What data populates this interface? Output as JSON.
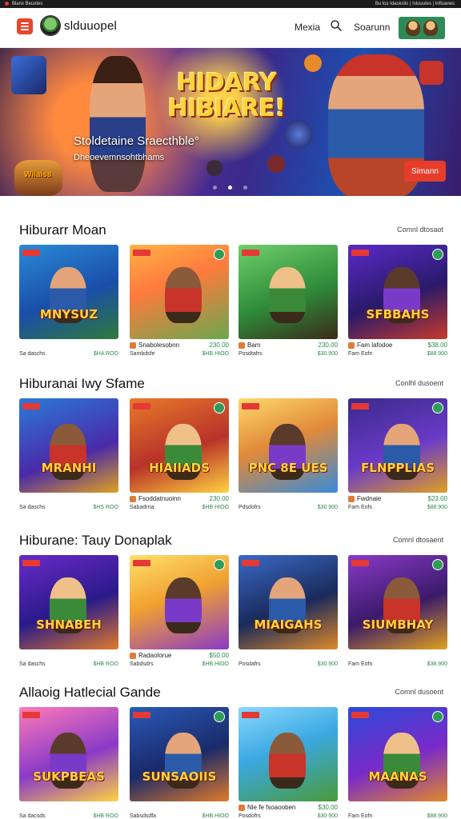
{
  "status_bar": {
    "left": "Blanx Beuxtes",
    "right": "Bu los Idaskslis | Isluuutes | lnfluanes"
  },
  "header": {
    "brand": "slduuopel",
    "nav": [
      "Mexia",
      "Soarunn"
    ]
  },
  "hero": {
    "title": "HIDARY HIBIARE!",
    "headline": "Stoldetaine Sraecthble°",
    "subline": "Dheoevemnsohtbhams",
    "small_logo": "Wilaiss",
    "cta": "Simann",
    "slides": 3,
    "active_slide": 2
  },
  "sections": [
    {
      "title": "Hiburarr Moan",
      "more": "Comnl dtosaot",
      "cards": [
        {
          "art": "MNYSUZ",
          "name": "",
          "value": "",
          "sub": "Sa daschs",
          "price": "$HA ROO"
        },
        {
          "art": "",
          "name": "Snabolesobnn",
          "value": "230.00",
          "sub": "Sambdsfe",
          "price": "$HB HIOO"
        },
        {
          "art": "",
          "name": "Bam",
          "value": "230.00",
          "sub": "Posdtafrs",
          "price": "$30.900"
        },
        {
          "art": "SFBBAHS",
          "name": "Fam lafodoe",
          "value": "$38.00",
          "sub": "Fam Eofn",
          "price": "$88.900"
        }
      ]
    },
    {
      "title": "Hiburanai Iwy Sfame",
      "more": "Conlhl dusoent",
      "cards": [
        {
          "art": "MRANHI",
          "name": "",
          "value": "",
          "sub": "Sa daschs",
          "price": "$HS ROO"
        },
        {
          "art": "HIAIIADS",
          "name": "Fsoddatnuoinn",
          "value": "230.00",
          "sub": "Sabadrna",
          "price": "$HB HIOO"
        },
        {
          "art": "PNC 8E UES",
          "name": "",
          "value": "",
          "sub": "Pdsdofrs",
          "price": "$30 900"
        },
        {
          "art": "FLNPPLIAS",
          "name": "Fwdnaie",
          "value": "$23.00",
          "sub": "Fam Eofs",
          "price": "$88.900"
        }
      ]
    },
    {
      "title": "Hiburane: Tauy Donaplak",
      "more": "Comnl dtosaent",
      "cards": [
        {
          "art": "SHNABEH",
          "name": "",
          "value": "",
          "sub": "Sa daschs",
          "price": "$HB ROO"
        },
        {
          "art": "",
          "name": "Radaolorue",
          "value": "$50.00",
          "sub": "Sabdsdrs",
          "price": "$HB HIOO"
        },
        {
          "art": "MIAIGAHS",
          "name": "",
          "value": "",
          "sub": "Posdafrs",
          "price": "$30.900"
        },
        {
          "art": "SIUMBHAY",
          "name": "",
          "value": "",
          "sub": "Fam Eofn",
          "price": "$38.900"
        }
      ]
    },
    {
      "title": "Allaoig Hatlecial Gande",
      "more": "Comnl dusoent",
      "cards": [
        {
          "art": "SUKPBEAS",
          "name": "",
          "value": "",
          "sub": "Sa dacsds",
          "price": "$HB ROO"
        },
        {
          "art": "SUNSAOIIS",
          "name": "",
          "value": "",
          "sub": "Sabsdsdfa",
          "price": "$HB HIOO"
        },
        {
          "art": "",
          "name": "Nle fe fsoaooben",
          "value": "$30.00",
          "sub": "Posdofrs",
          "price": "$30 900"
        },
        {
          "art": "MAANAS",
          "name": "",
          "value": "",
          "sub": "Fam Eofn",
          "price": "$88.900"
        }
      ]
    }
  ],
  "colors": {
    "accent": "#e53935",
    "price_green": "#2b8a4a",
    "avatar_bg": "#2e8b57"
  }
}
